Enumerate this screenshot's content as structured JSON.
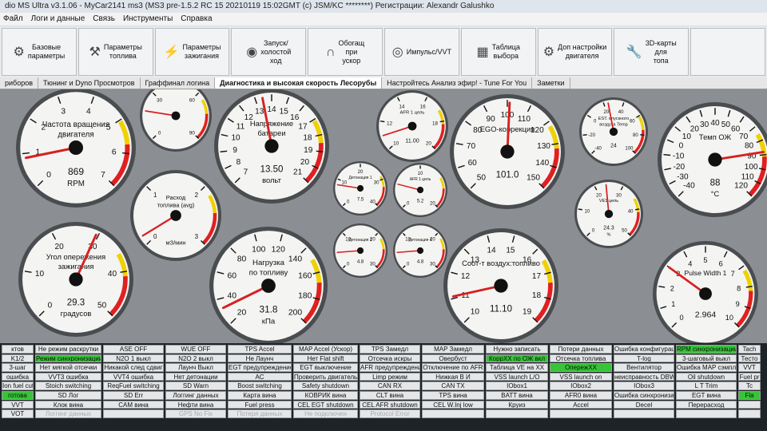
{
  "window": {
    "title": "dio MS Ultra v3.1.06 - MyCar2141 ms3 (MS3 pre-1.5.2 RC 15  20210119 15:02GMT (c) JSM/KC ********) Регистрации: Alexandr Galushko"
  },
  "menu": [
    "Файл",
    "Логи и данные",
    "Связь",
    "Инструменты",
    "Справка"
  ],
  "toolbar": [
    {
      "label": "Базовые\nпараметры",
      "icon": "gear-icon",
      "glyph": "⚙"
    },
    {
      "label": "Параметры\nтоплива",
      "icon": "injector-icon",
      "glyph": "⚒"
    },
    {
      "label": "Параметры\nзажигания",
      "icon": "spark-plug-icon",
      "glyph": "⚡"
    },
    {
      "label": "Запуск/\nхолостой\nход",
      "icon": "idle-valve-icon",
      "glyph": "◉"
    },
    {
      "label": "Обогащ\nпри\nускор",
      "icon": "magnet-icon",
      "glyph": "∩"
    },
    {
      "label": "Импульс/VVT",
      "icon": "turbo-icon",
      "glyph": "◎"
    },
    {
      "label": "Таблица\nвыбора",
      "icon": "table-icon",
      "glyph": "▦"
    },
    {
      "label": "Доп настройки\nдвигателя",
      "icon": "engine-icon",
      "glyph": "⚙"
    },
    {
      "label": "3D-карты\nдля\nтопа",
      "icon": "wrench-icon",
      "glyph": "🔧"
    },
    {
      "label": "",
      "icon": "more-icon",
      "glyph": ""
    }
  ],
  "tabs": [
    "риборов",
    "Тюнинг и Dyno Просмотров",
    "Граффинал логина",
    "Диагностика и высокая скорость Лесорубы",
    "Настройтесь Анализ эфир! - Tune For You",
    "Заметки"
  ],
  "active_tab": 3,
  "gauges": [
    {
      "id": "rpm",
      "title": "Частота вращения\nдвигателя",
      "value": "869",
      "unit": "RPM",
      "ticks": [
        "0",
        "1",
        "2",
        "3",
        "4",
        "5",
        "6",
        "7"
      ],
      "reading": 0.124
    },
    {
      "id": "gear-gauge",
      "title": "",
      "value": "",
      "unit": "",
      "ticks": [
        "0",
        "30",
        "60",
        "90"
      ],
      "reading": 0.2
    },
    {
      "id": "voltage",
      "title": "Напряжение\nбатареи",
      "value": "13.50",
      "unit": "вольт",
      "ticks": [
        "7",
        "8",
        "9",
        "10",
        "11",
        "12",
        "13",
        "14",
        "15",
        "16",
        "17",
        "18",
        "19",
        "20",
        "21"
      ],
      "reading": 0.46
    },
    {
      "id": "afr1",
      "title": "AFR 1 цель",
      "value": "11.00",
      "unit": "",
      "ticks": [
        "10",
        "12",
        "14",
        "16",
        "18",
        "20"
      ],
      "reading": 0.1
    },
    {
      "id": "ego",
      "title": "EGO-коррекция",
      "value": "101.0",
      "unit": "",
      "ticks": [
        "50",
        "60",
        "70",
        "80",
        "90",
        "100",
        "110",
        "120",
        "130",
        "140",
        "150"
      ],
      "reading": 0.51
    },
    {
      "id": "est-temp",
      "title": "EST. впускного\nвоздуха Temp",
      "value": "24",
      "unit": "",
      "ticks": [
        "-40",
        "-20",
        "0",
        "20",
        "40",
        "60",
        "80",
        "100"
      ],
      "reading": 0.46
    },
    {
      "id": "clt",
      "title": "Темп ОЖ",
      "value": "88",
      "unit": "°C",
      "ticks": [
        "-40",
        "-30",
        "-20",
        "-10",
        "0",
        "10",
        "20",
        "30",
        "40",
        "50",
        "60",
        "70",
        "80",
        "90",
        "100",
        "110",
        "120"
      ],
      "reading": 0.8
    },
    {
      "id": "fuel-flow",
      "title": "Расход\nтоплива (avg)",
      "value": "",
      "unit": "мЗ/мин",
      "ticks": [
        "0",
        "1",
        "2",
        "3"
      ],
      "reading": 0.05
    },
    {
      "id": "knock1",
      "title": "Детонация 1",
      "value": "7.5",
      "unit": "",
      "ticks": [
        "0",
        "10",
        "20",
        "30",
        "40"
      ],
      "reading": 0.2
    },
    {
      "id": "afr2",
      "title": "AFR 1 цель",
      "value": "5.2",
      "unit": "",
      "ticks": [
        "0",
        "10",
        "20"
      ],
      "reading": 0.22
    },
    {
      "id": "ve1",
      "title": "VE1 цель",
      "value": "24.3",
      "unit": "%",
      "ticks": [
        "0",
        "10",
        "20",
        "30",
        "40",
        "50"
      ],
      "reading": 0.48
    },
    {
      "id": "knock3",
      "title": "Детонация 3",
      "value": "4.8",
      "unit": "",
      "ticks": [
        "0",
        "10",
        "20",
        "30"
      ],
      "reading": 0.15
    },
    {
      "id": "knock4",
      "title": "Детонация 4",
      "value": "4.8",
      "unit": "",
      "ticks": [
        "0",
        "10",
        "20",
        "30"
      ],
      "reading": 0.15
    },
    {
      "id": "advance",
      "title": "Угол опережения\nзажигания",
      "value": "29.3",
      "unit": "градусов",
      "ticks": [
        "0",
        "10",
        "20",
        "30",
        "40",
        "50"
      ],
      "reading": 0.59
    },
    {
      "id": "load",
      "title": "Нагрузка\nпо топливу",
      "value": "31.8",
      "unit": "кПа",
      "ticks": [
        "20",
        "40",
        "60",
        "80",
        "100",
        "120",
        "140",
        "160",
        "180",
        "200"
      ],
      "reading": 0.07
    },
    {
      "id": "afr",
      "title": "Соот-т воздух:топливо",
      "value": "11.10",
      "unit": "",
      "ticks": [
        "10",
        "11",
        "12",
        "13",
        "14",
        "15",
        "16",
        "17",
        "18",
        "19"
      ],
      "reading": 0.12
    },
    {
      "id": "pw",
      "title": "Pulse Width 1",
      "value": "2.964",
      "unit": "",
      "ticks": [
        "0",
        "1",
        "2",
        "3",
        "4",
        "5",
        "6",
        "7",
        "8",
        "9",
        "10"
      ],
      "reading": 0.3
    }
  ],
  "panel": [
    {
      "items": [
        {
          "t": "ктов",
          "s": "off"
        },
        {
          "t": "K1/2",
          "s": "off"
        },
        {
          "t": "3-шаг",
          "s": "off"
        },
        {
          "t": "ошибка",
          "s": "off"
        },
        {
          "t": "Ion fuel cut",
          "s": "off"
        },
        {
          "t": "готова",
          "s": "on"
        },
        {
          "t": "VVT",
          "s": "off"
        },
        {
          "t": "VOT",
          "s": "off"
        }
      ]
    },
    {
      "items": [
        {
          "t": "Не режим раскрутки",
          "s": "off"
        },
        {
          "t": "Режим синхронизации RPM",
          "s": "on"
        },
        {
          "t": "Нет мягкой отсечки",
          "s": "off"
        },
        {
          "t": "VVT3 ошибка",
          "s": "off"
        },
        {
          "t": "Stoich switching",
          "s": "off"
        },
        {
          "t": "SD Лог",
          "s": "off"
        },
        {
          "t": "Клок вина",
          "s": "off"
        },
        {
          "t": "Логгинг данных",
          "s": "dim"
        }
      ]
    },
    {
      "items": [
        {
          "t": "ASE OFF",
          "s": "off"
        },
        {
          "t": "N2O 1 выкл",
          "s": "off"
        },
        {
          "t": "Никакой след сдвиг",
          "s": "off"
        },
        {
          "t": "VVT4 ошибка",
          "s": "off"
        },
        {
          "t": "ReqFuel switching",
          "s": "off"
        },
        {
          "t": "SD Err",
          "s": "off"
        },
        {
          "t": "CAM вина",
          "s": "off"
        },
        {
          "t": "",
          "s": "off"
        }
      ]
    },
    {
      "items": [
        {
          "t": "WUE OFF",
          "s": "off"
        },
        {
          "t": "N2O 2 выкл",
          "s": "off"
        },
        {
          "t": "Лаунч Выкл",
          "s": "off"
        },
        {
          "t": "Нет детонации",
          "s": "off"
        },
        {
          "t": "SD Warn",
          "s": "off"
        },
        {
          "t": "Логгинг данных",
          "s": "off"
        },
        {
          "t": "Нефти вина",
          "s": "off"
        },
        {
          "t": "GPS No Fix",
          "s": "dim"
        }
      ]
    },
    {
      "items": [
        {
          "t": "TPS Accel",
          "s": "off"
        },
        {
          "t": "Не Лаунч",
          "s": "off"
        },
        {
          "t": "EGT предупреждение",
          "s": "off"
        },
        {
          "t": "AC",
          "s": "off"
        },
        {
          "t": "Boost switching",
          "s": "off"
        },
        {
          "t": "Карта вина",
          "s": "off"
        },
        {
          "t": "Fuel press",
          "s": "off"
        },
        {
          "t": "Потеря данных",
          "s": "dim"
        }
      ]
    },
    {
      "items": [
        {
          "t": "MAP Accel (Ускор)",
          "s": "off"
        },
        {
          "t": "Нет Flat shift",
          "s": "off"
        },
        {
          "t": "EGT выключение",
          "s": "off"
        },
        {
          "t": "Проверить двигатель",
          "s": "off"
        },
        {
          "t": "Safety shutdown",
          "s": "off"
        },
        {
          "t": "КОВРИК вина",
          "s": "off"
        },
        {
          "t": "CEL EGT shutdown",
          "s": "off"
        },
        {
          "t": "Не подключен",
          "s": "dim"
        }
      ]
    },
    {
      "items": [
        {
          "t": "TPS Замедл",
          "s": "off"
        },
        {
          "t": "Отсечка искры",
          "s": "off"
        },
        {
          "t": "AFR предупреждение",
          "s": "off"
        },
        {
          "t": "Limp режим",
          "s": "off"
        },
        {
          "t": "CAN RX",
          "s": "off"
        },
        {
          "t": "CLT вина",
          "s": "off"
        },
        {
          "t": "CEL AFR shutdown",
          "s": "off"
        },
        {
          "t": "Protocol Error",
          "s": "dim"
        }
      ]
    },
    {
      "items": [
        {
          "t": "MAP Замедл",
          "s": "off"
        },
        {
          "t": "Овербуст",
          "s": "off"
        },
        {
          "t": "Отключение по AFR",
          "s": "off"
        },
        {
          "t": "Нижкая В И",
          "s": "off"
        },
        {
          "t": "CAN TX",
          "s": "off"
        },
        {
          "t": "TPS вина",
          "s": "off"
        },
        {
          "t": "CEL W.Inj low",
          "s": "off"
        },
        {
          "t": "",
          "s": "off"
        }
      ]
    },
    {
      "items": [
        {
          "t": "Нужно записать",
          "s": "off"
        },
        {
          "t": "КоррХХ по ОЖ вкл",
          "s": "on"
        },
        {
          "t": "Таблица VE на ХХ",
          "s": "off"
        },
        {
          "t": "VSS launch L/O",
          "s": "off"
        },
        {
          "t": "IObox1",
          "s": "off"
        },
        {
          "t": "BATT вина",
          "s": "off"
        },
        {
          "t": "Круиз",
          "s": "off"
        },
        {
          "t": "",
          "s": "off"
        }
      ]
    },
    {
      "items": [
        {
          "t": "Потери данных",
          "s": "off"
        },
        {
          "t": "Отсечка топлива",
          "s": "off"
        },
        {
          "t": "ОпережХХ",
          "s": "on"
        },
        {
          "t": "VSS launch on",
          "s": "off"
        },
        {
          "t": "IObox2",
          "s": "off"
        },
        {
          "t": "AFR0 вина",
          "s": "off"
        },
        {
          "t": "Accel",
          "s": "off"
        },
        {
          "t": "",
          "s": "off"
        }
      ]
    },
    {
      "items": [
        {
          "t": "Ошибка конфигурации",
          "s": "off"
        },
        {
          "t": "T-log",
          "s": "off"
        },
        {
          "t": "Вентилятор",
          "s": "off"
        },
        {
          "t": "неисправность DBW",
          "s": "off"
        },
        {
          "t": "IObox3",
          "s": "off"
        },
        {
          "t": "Ошибка синхронизации",
          "s": "off"
        },
        {
          "t": "Decel",
          "s": "off"
        },
        {
          "t": "",
          "s": "off"
        }
      ]
    },
    {
      "items": [
        {
          "t": "RPM синхронизации",
          "s": "on"
        },
        {
          "t": "3-шаговый выкл",
          "s": "off"
        },
        {
          "t": "Ошибка MAP сэмплинг",
          "s": "off"
        },
        {
          "t": "Oil shutdown",
          "s": "off"
        },
        {
          "t": "L T Trim",
          "s": "off"
        },
        {
          "t": "EGT вина",
          "s": "off"
        },
        {
          "t": "Перерасход",
          "s": "off"
        },
        {
          "t": "",
          "s": "off"
        }
      ]
    },
    {
      "items": [
        {
          "t": "Tach",
          "s": "off"
        },
        {
          "t": "Тесто",
          "s": "off"
        },
        {
          "t": "VVT",
          "s": "off"
        },
        {
          "t": "Fuel pr",
          "s": "off"
        },
        {
          "t": "Tc",
          "s": "off"
        },
        {
          "t": "Fla",
          "s": "on"
        },
        {
          "t": "",
          "s": "off"
        },
        {
          "t": "",
          "s": "off"
        }
      ]
    }
  ],
  "colors": {
    "background": "#8b8e92",
    "needle": "#d62020",
    "panel": "#1e2327",
    "green": "#37c437"
  }
}
